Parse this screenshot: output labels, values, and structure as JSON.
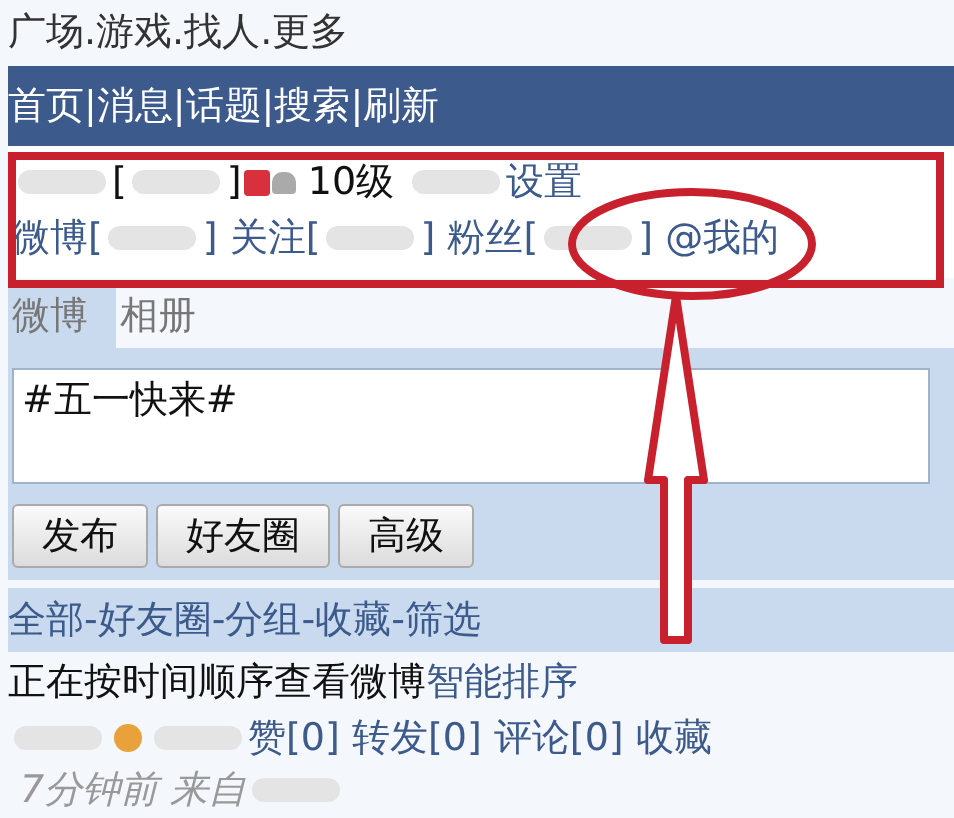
{
  "top_links": "广场.游戏.找人.更多",
  "nav_bar": "首页|消息|话题|搜索|刷新",
  "profile": {
    "line_1": [
      {
        "kind": "blur"
      },
      {
        "kind": "text",
        "text": "["
      },
      {
        "kind": "blur"
      },
      {
        "kind": "text",
        "text": "]"
      },
      {
        "kind": "badge"
      },
      {
        "kind": "crown"
      },
      {
        "kind": "text",
        "text": " 10级 "
      },
      {
        "kind": "blur"
      },
      {
        "kind": "link",
        "text": "设置"
      }
    ],
    "line_2": [
      {
        "kind": "link",
        "text": "微博["
      },
      {
        "kind": "blur"
      },
      {
        "kind": "link",
        "text": "] 关注["
      },
      {
        "kind": "blur"
      },
      {
        "kind": "link",
        "text": "] 粉丝["
      },
      {
        "kind": "blur"
      },
      {
        "kind": "link",
        "text": "] @我的"
      }
    ]
  },
  "tabs": [
    {
      "label": "微博",
      "selected": true
    },
    {
      "label": "相册",
      "selected": false
    }
  ],
  "composer": {
    "value": "#五一快来#"
  },
  "buttons": [
    "发布",
    "好友圈",
    "高级"
  ],
  "filters": {
    "separator": "-",
    "items": [
      "全部",
      "好友圈",
      "分组",
      "收藏",
      "筛选"
    ]
  },
  "sort_notice": {
    "text": "正在按时间顺序查看微博",
    "link": "智能排序"
  },
  "post": [
    {
      "kind": "blur"
    },
    {
      "kind": "emoji"
    },
    {
      "kind": "blur"
    },
    {
      "kind": "link",
      "text": "赞[0] 转发[0] 评论[0] 收藏"
    },
    {
      "kind": "meta",
      "text": "7分钟前 来自"
    },
    {
      "kind": "blur"
    }
  ]
}
